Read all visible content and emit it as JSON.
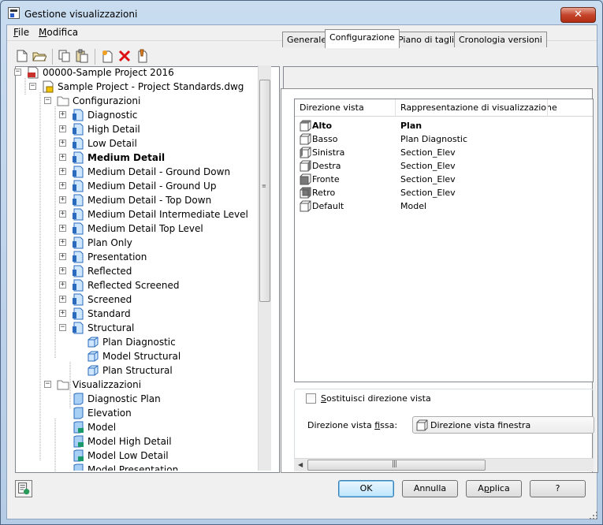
{
  "window": {
    "title": "Gestione visualizzazioni",
    "close_label": "✕"
  },
  "menu": {
    "file": {
      "accel": "F",
      "rest": "ile"
    },
    "modifica": {
      "accel": "M",
      "rest": "odifica"
    }
  },
  "tree": {
    "rows": [
      {
        "label": "00000-Sample Project 2016"
      },
      {
        "label": "Sample Project - Project Standards.dwg"
      },
      {
        "label": "Configurazioni"
      },
      {
        "label": "Diagnostic"
      },
      {
        "label": "High Detail"
      },
      {
        "label": "Low Detail"
      },
      {
        "label": "Medium Detail"
      },
      {
        "label": "Medium Detail - Ground Down"
      },
      {
        "label": "Medium Detail - Ground Up"
      },
      {
        "label": "Medium Detail - Top Down"
      },
      {
        "label": "Medium Detail Intermediate Level"
      },
      {
        "label": "Medium Detail Top Level"
      },
      {
        "label": "Plan Only"
      },
      {
        "label": "Presentation"
      },
      {
        "label": "Reflected"
      },
      {
        "label": "Reflected Screened"
      },
      {
        "label": "Screened"
      },
      {
        "label": "Standard"
      },
      {
        "label": "Structural"
      },
      {
        "label": "Plan Diagnostic"
      },
      {
        "label": "Model Structural"
      },
      {
        "label": "Plan Structural"
      },
      {
        "label": "Visualizzazioni"
      },
      {
        "label": "Diagnostic Plan"
      },
      {
        "label": "Elevation"
      },
      {
        "label": "Model"
      },
      {
        "label": "Model High Detail"
      },
      {
        "label": "Model Low Detail"
      },
      {
        "label": "Model Presentation"
      }
    ]
  },
  "tabs": [
    {
      "label": "Generale"
    },
    {
      "label": "Configurazione"
    },
    {
      "label": "Piano di taglio"
    },
    {
      "label": "Cronologia versioni"
    }
  ],
  "list": {
    "headers": {
      "direction": "Direzione vista",
      "representation": "Rappresentazione di visualizzazione"
    },
    "rows": [
      {
        "direction": "Alto",
        "representation": "Plan"
      },
      {
        "direction": "Basso",
        "representation": "Plan Diagnostic"
      },
      {
        "direction": "Sinistra",
        "representation": "Section_Elev"
      },
      {
        "direction": "Destra",
        "representation": "Section_Elev"
      },
      {
        "direction": "Fronte",
        "representation": "Section_Elev"
      },
      {
        "direction": "Retro",
        "representation": "Section_Elev"
      },
      {
        "direction": "Default",
        "representation": "Model"
      }
    ]
  },
  "override": {
    "checkbox_accel": "S",
    "checkbox_rest": "ostituisci direzione vista",
    "checked": false,
    "fixed_label_pre": "Direzione vista ",
    "fixed_label_accel": "f",
    "fixed_label_post": "issa:",
    "fixed_value": "Direzione vista finestra"
  },
  "buttons": {
    "ok": "OK",
    "cancel": "Annulla",
    "apply_pre": "A",
    "apply_accel": "p",
    "apply_post": "plica",
    "help": "?"
  }
}
